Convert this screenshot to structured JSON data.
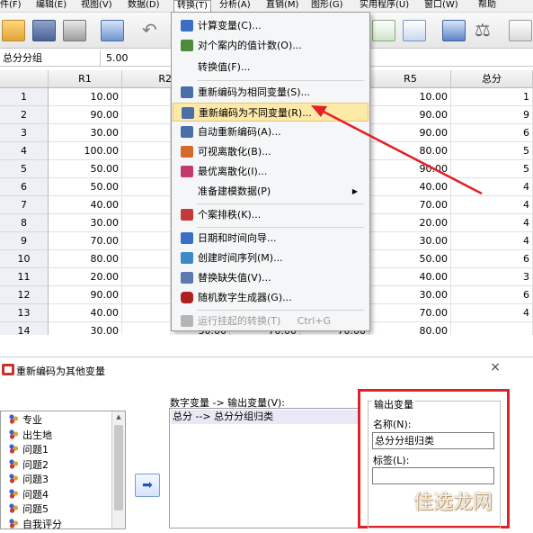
{
  "menubar": [
    "件(F)",
    "编辑(E)",
    "视图(V)",
    "数据(D)",
    "转换(T)",
    "分析(A)",
    "直销(M)",
    "图形(G)",
    "实用程序(U)",
    "窗口(W)",
    "帮助"
  ],
  "active_cell": {
    "variable": "总分分组",
    "value": "5.00"
  },
  "columns": [
    "",
    "R1",
    "R2",
    "R5",
    "总分"
  ],
  "rows": [
    {
      "n": "1",
      "r1": "10.00",
      "r5": "10.00",
      "tot": "1"
    },
    {
      "n": "2",
      "r1": "90.00",
      "r5": "90.00",
      "tot": "9"
    },
    {
      "n": "3",
      "r1": "30.00",
      "r5": "90.00",
      "tot": "6"
    },
    {
      "n": "4",
      "r1": "100.00",
      "r5": "80.00",
      "tot": "5"
    },
    {
      "n": "5",
      "r1": "50.00",
      "r5": "90.00",
      "tot": "5"
    },
    {
      "n": "6",
      "r1": "50.00",
      "r5": "40.00",
      "tot": "4"
    },
    {
      "n": "7",
      "r1": "40.00",
      "r5": "70.00",
      "tot": "4"
    },
    {
      "n": "8",
      "r1": "30.00",
      "r5": "20.00",
      "tot": "4"
    },
    {
      "n": "9",
      "r1": "70.00",
      "r5": "30.00",
      "tot": "4"
    },
    {
      "n": "10",
      "r1": "80.00",
      "r5": "50.00",
      "tot": "6"
    },
    {
      "n": "11",
      "r1": "20.00",
      "r5": "40.00",
      "tot": "3"
    },
    {
      "n": "12",
      "r1": "90.00",
      "r5": "30.00",
      "tot": "6"
    },
    {
      "n": "13",
      "r1": "40.00",
      "r5": "70.00",
      "tot": "4"
    },
    {
      "n": "14",
      "r1": "30.00",
      "r5": "80.00",
      "tot": ""
    }
  ],
  "row14_extra": [
    "30.00",
    "70.00",
    "70.00"
  ],
  "transform_menu": [
    {
      "label": "计算变量(C)...",
      "icon_color": "#3a6fc4"
    },
    {
      "label": "对个案内的值计数(O)...",
      "icon_color": "#4c8a3c"
    },
    {
      "label": "转换值(F)...",
      "icon_color": ""
    },
    {
      "label": "重新编码为相同变量(S)...",
      "icon_color": "#4a6fa8"
    },
    {
      "label": "重新编码为不同变量(R)...",
      "icon_color": "#4a6fa8",
      "highlighted": true
    },
    {
      "label": "自动重新编码(A)...",
      "icon_color": "#4a6fa8"
    },
    {
      "label": "可视离散化(B)...",
      "icon_color": "#d46b2a"
    },
    {
      "label": "最优离散化(I)...",
      "icon_color": "#c23a6b"
    },
    {
      "label": "准备建模数据(P)",
      "icon_color": "",
      "submenu": true
    },
    {
      "label": "个案排秩(K)...",
      "icon_color": "#c23a3a"
    },
    {
      "label": "日期和时间向导...",
      "icon_color": "#3a6fc4"
    },
    {
      "label": "创建时间序列(M)...",
      "icon_color": "#3a8ac4"
    },
    {
      "label": "替换缺失值(V)...",
      "icon_color": "#5a7ab0"
    },
    {
      "label": "随机数字生成器(G)...",
      "icon_color": "#b02020"
    },
    {
      "label": "运行挂起的转换(T)",
      "icon_color": "#9a9a9a",
      "disabled": true,
      "shortcut": "Ctrl+G"
    }
  ],
  "dialog": {
    "title": "重新编码为其他变量",
    "close": "×",
    "source_vars": [
      "专业",
      "出生地",
      "问题1",
      "问题2",
      "问题3",
      "问题4",
      "问题5",
      "自我评分"
    ],
    "map_label": "数字变量 -> 输出变量(V):",
    "mapping": "总分 --> 总分分组归类",
    "output_legend": "输出变量",
    "name_label": "名称(N):",
    "name_value": "总分分组归类",
    "label_label": "标签(L):",
    "label_value": ""
  },
  "watermark": "佳选龙网",
  "colors": {
    "highlight": "#fde9a8",
    "annotation_red": "#e22127"
  }
}
